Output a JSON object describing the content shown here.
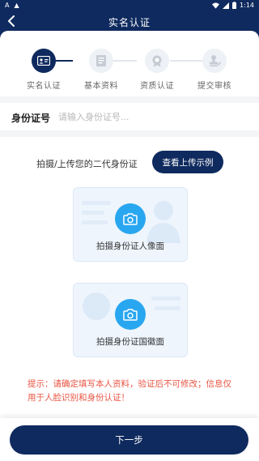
{
  "status_bar": {
    "left_icons": [
      "A",
      "▲"
    ],
    "time": "1:14"
  },
  "app_bar": {
    "title": "实名认证"
  },
  "steps": [
    {
      "label": "实名认证",
      "icon": "id-card-icon",
      "active": true
    },
    {
      "label": "基本资料",
      "icon": "document-icon",
      "active": false
    },
    {
      "label": "资质认证",
      "icon": "badge-icon",
      "active": false
    },
    {
      "label": "提交审核",
      "icon": "stamp-icon",
      "active": false
    }
  ],
  "id_field": {
    "label": "身份证号",
    "placeholder": "请输入身份证号...",
    "value": ""
  },
  "upload": {
    "title": "拍摄/上传您的二代身份证",
    "example_button": "查看上传示例",
    "front_label": "拍摄身份证人像面",
    "back_label": "拍摄身份证国徽面"
  },
  "tip": {
    "text": "提示：请确定填写本人资料，验证后不可修改；信息仅用于人脸识别和身份认证！"
  },
  "next_button": "下一步",
  "colors": {
    "primary": "#0f2a5e",
    "camera": "#29a6f0",
    "warning": "#e85442",
    "card_bg": "#eef5fd"
  }
}
